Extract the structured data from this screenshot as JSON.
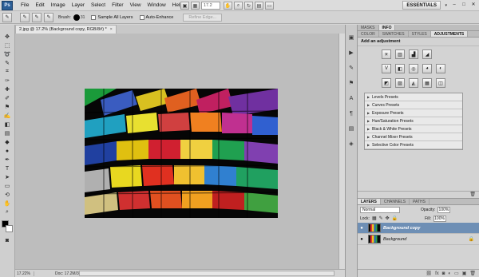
{
  "menubar": {
    "logo": "Ps",
    "items": [
      "File",
      "Edit",
      "Image",
      "Layer",
      "Select",
      "Filter",
      "View",
      "Window",
      "Help"
    ],
    "zoom": "17.2",
    "workspace": "ESSENTIALS",
    "workspace_arrow": "▾",
    "window_controls": [
      "–",
      "□",
      "✕"
    ]
  },
  "options": {
    "brush_label": "Brush:",
    "brush_size": "31",
    "sample_all_layers": "Sample All Layers",
    "auto_enhance": "Auto-Enhance",
    "refine_edge": "Refine Edge..."
  },
  "document": {
    "tab_title": "2.jpg @ 17.2% (Background copy, RGB/8#) *",
    "tab_close": "×",
    "zoom": "17.22%",
    "doc_info": "Doc: 17.2M/34.4M"
  },
  "top_tabs": [
    "MASKS",
    "INFO"
  ],
  "adjust_tabs": [
    "COLOR",
    "SWATCHES",
    "STYLES",
    "ADJUSTMENTS"
  ],
  "adjustments": {
    "title": "Add an adjustment",
    "row1": [
      "☀",
      "▥",
      "▟",
      "◢",
      "▼"
    ],
    "row2": [
      "V",
      "◧",
      "◎",
      "◕",
      "◐"
    ],
    "row3": [
      "◩",
      "▨",
      "◭",
      "▦",
      "◫"
    ],
    "presets": [
      "Levels Presets",
      "Curves Presets",
      "Exposure Presets",
      "Hue/Saturation Presets",
      "Black & White Presets",
      "Channel Mixer Presets",
      "Selective Color Presets"
    ]
  },
  "layers": {
    "tabs": [
      "LAYERS",
      "CHANNELS",
      "PATHS"
    ],
    "blend_mode": "Normal",
    "opacity_label": "Opacity:",
    "opacity": "100%",
    "lock_label": "Lock:",
    "fill_label": "Fill:",
    "fill": "100%",
    "items": [
      {
        "name": "Background copy",
        "active": true
      },
      {
        "name": "Background",
        "active": false
      }
    ]
  }
}
